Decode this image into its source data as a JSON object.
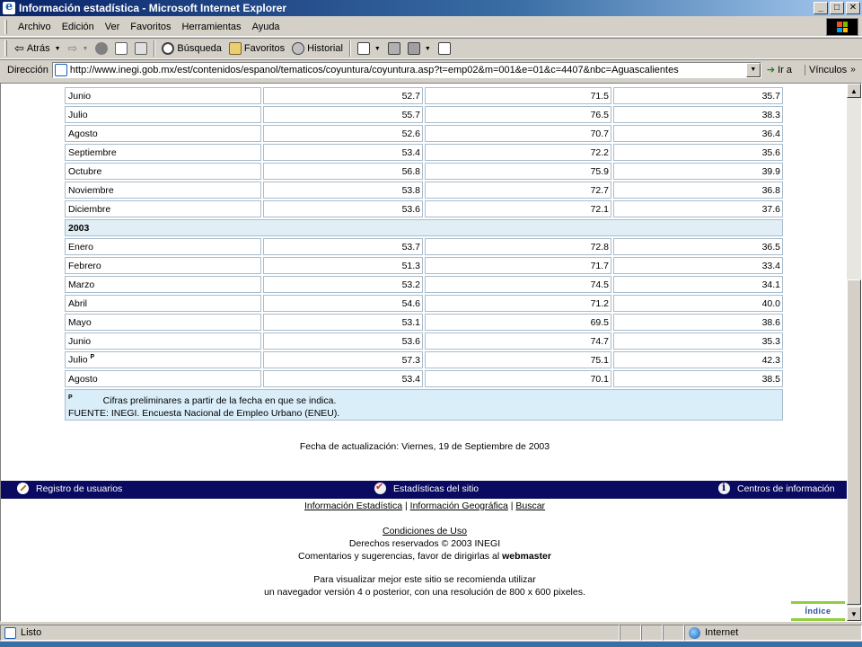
{
  "window": {
    "title": "Información estadística - Microsoft Internet Explorer",
    "min_glyph": "_",
    "max_glyph": "□",
    "close_glyph": "✕"
  },
  "menu": [
    "Archivo",
    "Edición",
    "Ver",
    "Favoritos",
    "Herramientas",
    "Ayuda"
  ],
  "toolbar": {
    "back": "Atrás",
    "search": "Búsqueda",
    "favorites": "Favoritos",
    "history": "Historial"
  },
  "address": {
    "label": "Dirección",
    "url": "http://www.inegi.gob.mx/est/contenidos/espanol/tematicos/coyuntura/coyuntura.asp?t=emp02&m=001&e=01&c=4407&nbc=Aguascalientes",
    "go": "Ir a",
    "links": "Vínculos"
  },
  "table": {
    "rows_2002": [
      {
        "month": "Junio",
        "a": "52.7",
        "b": "71.5",
        "c": "35.7"
      },
      {
        "month": "Julio",
        "a": "55.7",
        "b": "76.5",
        "c": "38.3"
      },
      {
        "month": "Agosto",
        "a": "52.6",
        "b": "70.7",
        "c": "36.4"
      },
      {
        "month": "Septiembre",
        "a": "53.4",
        "b": "72.2",
        "c": "35.6"
      },
      {
        "month": "Octubre",
        "a": "56.8",
        "b": "75.9",
        "c": "39.9"
      },
      {
        "month": "Noviembre",
        "a": "53.8",
        "b": "72.7",
        "c": "36.8"
      },
      {
        "month": "Diciembre",
        "a": "53.6",
        "b": "72.1",
        "c": "37.6"
      }
    ],
    "year_2003": "2003",
    "rows_2003": [
      {
        "month": "Enero",
        "a": "53.7",
        "b": "72.8",
        "c": "36.5"
      },
      {
        "month": "Febrero",
        "a": "51.3",
        "b": "71.7",
        "c": "33.4"
      },
      {
        "month": "Marzo",
        "a": "53.2",
        "b": "74.5",
        "c": "34.1"
      },
      {
        "month": "Abril",
        "a": "54.6",
        "b": "71.2",
        "c": "40.0"
      },
      {
        "month": "Mayo",
        "a": "53.1",
        "b": "69.5",
        "c": "38.6"
      },
      {
        "month": "Junio",
        "a": "53.6",
        "b": "74.7",
        "c": "35.3"
      },
      {
        "month": "Julio",
        "sup": "P",
        "a": "57.3",
        "b": "75.1",
        "c": "42.3"
      },
      {
        "month": "Agosto",
        "a": "53.4",
        "b": "70.1",
        "c": "38.5"
      }
    ],
    "note_mark": "P",
    "note_text": "Cifras preliminares a partir de la fecha en que se indica.",
    "source": "FUENTE: INEGI. Encuesta Nacional de Empleo Urbano (ENEU)."
  },
  "updated": "Fecha de actualización: Viernes, 19 de Septiembre de 2003",
  "navband": {
    "registro": "Registro de usuarios",
    "estadisticas": "Estadísticas del sitio",
    "centros": "Centros de información"
  },
  "footer": {
    "link1": "Información Estadística",
    "sep": "|",
    "link2": "Información Geográfica",
    "link3": "Buscar",
    "conditions": "Condiciones de Uso",
    "rights": "Derechos reservados © 2003 INEGI",
    "comments": "Comentarios y sugerencias, favor de dirigirlas al",
    "webmaster": "webmaster",
    "rec1": "Para visualizar mejor este sitio se recomienda utilizar",
    "rec2": "un navegador versión 4 o posterior, con una resolución de 800 x 600 pixeles."
  },
  "indice": "Índice",
  "status": {
    "text": "Listo",
    "zone": "Internet"
  },
  "colors": {
    "titlebar": "#0a246a",
    "navband": "#0a0a60",
    "note_bg": "#daeefa",
    "year_bg": "#e1eef6"
  }
}
